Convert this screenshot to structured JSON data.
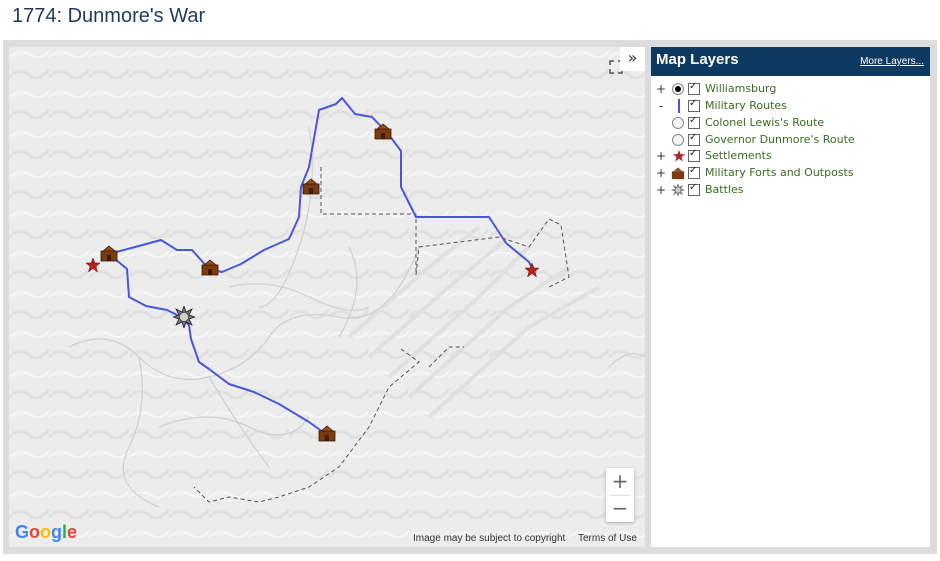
{
  "page": {
    "title": "1774: Dunmore's War"
  },
  "map": {
    "expand_label": "»",
    "zoom_in": "+",
    "zoom_out": "−",
    "google_logo": [
      "G",
      "o",
      "o",
      "g",
      "l",
      "e"
    ],
    "google_colors": [
      "#4285F4",
      "#EA4335",
      "#FBBC05",
      "#4285F4",
      "#34A853",
      "#EA4335"
    ],
    "copyright": "Image may be subject to copyright",
    "terms": "Terms of Use",
    "route_color": "#4a56d8",
    "settlement_color": "#b22222",
    "fort_color": "#7a3b12"
  },
  "panel": {
    "title": "Map Layers",
    "more_link": "More Layers...",
    "layers": [
      {
        "toggle": "+",
        "control": "radio-on",
        "symbol": "none",
        "checked": true,
        "label": "Williamsburg"
      },
      {
        "toggle": "-",
        "control": "none",
        "symbol": "route-line-icon",
        "checked": true,
        "label": "Military Routes"
      },
      {
        "toggle": "",
        "control": "radio-off",
        "symbol": "none",
        "checked": true,
        "label": "Colonel Lewis's Route"
      },
      {
        "toggle": "",
        "control": "radio-off",
        "symbol": "none",
        "checked": true,
        "label": "Governor Dunmore's Route"
      },
      {
        "toggle": "+",
        "control": "none",
        "symbol": "star-icon",
        "checked": true,
        "label": "Settlements"
      },
      {
        "toggle": "+",
        "control": "none",
        "symbol": "fort-icon",
        "checked": true,
        "label": "Military Forts and Outposts"
      },
      {
        "toggle": "+",
        "control": "none",
        "symbol": "battle-icon",
        "checked": true,
        "label": "Battles"
      }
    ]
  }
}
